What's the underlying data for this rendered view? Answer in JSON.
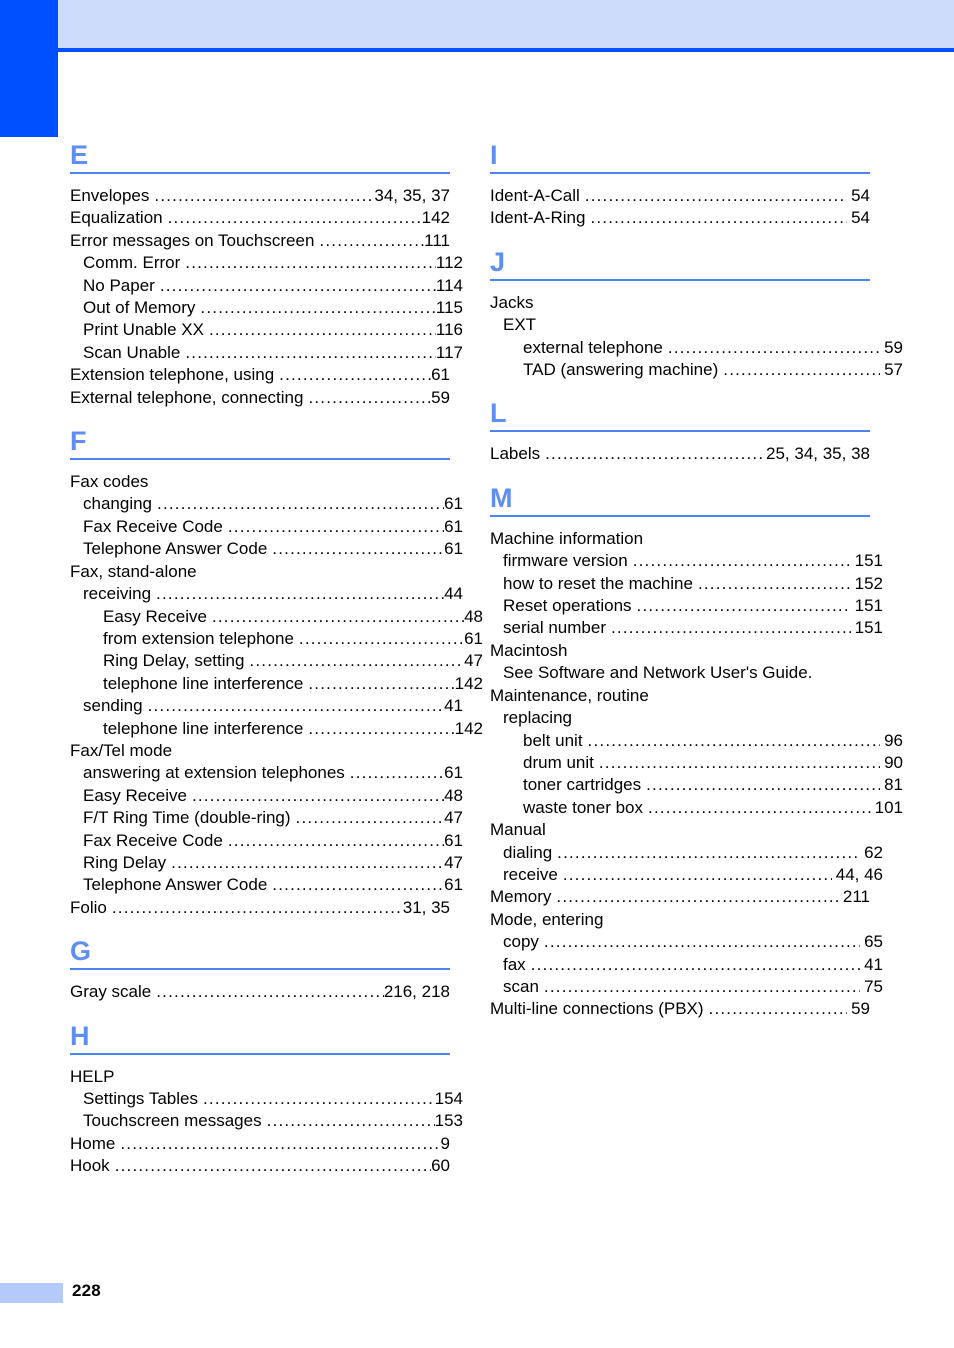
{
  "page": {
    "number": "228",
    "accent_dark_blue": "#0050ff",
    "accent_band_blue": "#ccdcfa",
    "accent_letter_blue": "#5e8ef2",
    "accent_rule_blue": "#4c85f0",
    "footer_block_blue": "#b3cafb"
  },
  "columns": [
    {
      "id": "left",
      "sections": [
        {
          "letter": "E",
          "entries": [
            {
              "label": "Envelopes",
              "pages": "34, 35, 37",
              "level": 0,
              "leader": true
            },
            {
              "label": "Equalization",
              "pages": "142",
              "level": 0,
              "leader": true
            },
            {
              "label": "Error messages on Touchscreen",
              "pages": "111",
              "level": 0,
              "leader": true
            },
            {
              "label": "Comm. Error",
              "pages": "112",
              "level": 1,
              "leader": true
            },
            {
              "label": "No Paper",
              "pages": "114",
              "level": 1,
              "leader": true
            },
            {
              "label": "Out of Memory",
              "pages": "115",
              "level": 1,
              "leader": true
            },
            {
              "label": "Print Unable XX",
              "pages": "116",
              "level": 1,
              "leader": true
            },
            {
              "label": "Scan Unable",
              "pages": "117",
              "level": 1,
              "leader": true
            },
            {
              "label": "Extension telephone, using",
              "pages": "61",
              "level": 0,
              "leader": true
            },
            {
              "label": "External telephone, connecting",
              "pages": "59",
              "level": 0,
              "leader": true
            }
          ]
        },
        {
          "letter": "F",
          "entries": [
            {
              "label": "Fax codes",
              "pages": "",
              "level": 0,
              "leader": false
            },
            {
              "label": "changing",
              "pages": "61",
              "level": 1,
              "leader": true
            },
            {
              "label": "Fax Receive Code",
              "pages": "61",
              "level": 1,
              "leader": true
            },
            {
              "label": "Telephone Answer Code",
              "pages": "61",
              "level": 1,
              "leader": true
            },
            {
              "label": "Fax, stand-alone",
              "pages": "",
              "level": 0,
              "leader": false
            },
            {
              "label": "receiving",
              "pages": "44",
              "level": 1,
              "leader": true
            },
            {
              "label": "Easy Receive",
              "pages": "48",
              "level": 2,
              "leader": true
            },
            {
              "label": "from extension telephone",
              "pages": "61",
              "level": 2,
              "leader": true
            },
            {
              "label": "Ring Delay, setting",
              "pages": "47",
              "level": 2,
              "leader": true
            },
            {
              "label": "telephone line interference",
              "pages": "142",
              "level": 2,
              "leader": true
            },
            {
              "label": "sending",
              "pages": "41",
              "level": 1,
              "leader": true
            },
            {
              "label": "telephone line interference",
              "pages": "142",
              "level": 2,
              "leader": true
            },
            {
              "label": "Fax/Tel mode",
              "pages": "",
              "level": 0,
              "leader": false
            },
            {
              "label": "answering at extension telephones",
              "pages": "61",
              "level": 1,
              "leader": true
            },
            {
              "label": "Easy Receive",
              "pages": "48",
              "level": 1,
              "leader": true
            },
            {
              "label": "F/T Ring Time (double-ring)",
              "pages": "47",
              "level": 1,
              "leader": true
            },
            {
              "label": "Fax Receive Code",
              "pages": "61",
              "level": 1,
              "leader": true
            },
            {
              "label": "Ring Delay",
              "pages": "47",
              "level": 1,
              "leader": true
            },
            {
              "label": "Telephone Answer Code",
              "pages": "61",
              "level": 1,
              "leader": true
            },
            {
              "label": "Folio",
              "pages": "31, 35",
              "level": 0,
              "leader": true
            }
          ]
        },
        {
          "letter": "G",
          "entries": [
            {
              "label": "Gray scale",
              "pages": "216, 218",
              "level": 0,
              "leader": true
            }
          ]
        },
        {
          "letter": "H",
          "entries": [
            {
              "label": "HELP",
              "pages": "",
              "level": 0,
              "leader": false
            },
            {
              "label": "Settings Tables",
              "pages": "154",
              "level": 1,
              "leader": true
            },
            {
              "label": "Touchscreen messages",
              "pages": "153",
              "level": 1,
              "leader": true
            },
            {
              "label": "Home",
              "pages": "9",
              "level": 0,
              "leader": true
            },
            {
              "label": "Hook",
              "pages": "60",
              "level": 0,
              "leader": true
            }
          ]
        }
      ]
    },
    {
      "id": "right",
      "sections": [
        {
          "letter": "I",
          "entries": [
            {
              "label": "Ident-A-Call",
              "pages": "54",
              "level": 0,
              "leader": true
            },
            {
              "label": "Ident-A-Ring",
              "pages": "54",
              "level": 0,
              "leader": true
            }
          ]
        },
        {
          "letter": "J",
          "entries": [
            {
              "label": "Jacks",
              "pages": "",
              "level": 0,
              "leader": false
            },
            {
              "label": "EXT",
              "pages": "",
              "level": 1,
              "leader": false
            },
            {
              "label": "external telephone",
              "pages": "59",
              "level": 2,
              "leader": true
            },
            {
              "label": "TAD (answering machine)",
              "pages": "57",
              "level": 2,
              "leader": true
            }
          ]
        },
        {
          "letter": "L",
          "entries": [
            {
              "label": "Labels",
              "pages": "25, 34, 35, 38",
              "level": 0,
              "leader": true
            }
          ]
        },
        {
          "letter": "M",
          "entries": [
            {
              "label": "Machine information",
              "pages": "",
              "level": 0,
              "leader": false
            },
            {
              "label": "firmware version",
              "pages": "151",
              "level": 1,
              "leader": true
            },
            {
              "label": "how to reset the machine",
              "pages": "152",
              "level": 1,
              "leader": true
            },
            {
              "label": "Reset operations",
              "pages": "151",
              "level": 1,
              "leader": true
            },
            {
              "label": "serial number",
              "pages": "151",
              "level": 1,
              "leader": true
            },
            {
              "label": "Macintosh",
              "pages": "",
              "level": 0,
              "leader": false
            },
            {
              "label": "See Software and Network User's Guide.",
              "pages": "",
              "level": 1,
              "leader": false
            },
            {
              "label": "Maintenance, routine",
              "pages": "",
              "level": 0,
              "leader": false
            },
            {
              "label": "replacing",
              "pages": "",
              "level": 1,
              "leader": false
            },
            {
              "label": "belt unit",
              "pages": "96",
              "level": 2,
              "leader": true
            },
            {
              "label": "drum unit",
              "pages": "90",
              "level": 2,
              "leader": true
            },
            {
              "label": "toner cartridges",
              "pages": "81",
              "level": 2,
              "leader": true
            },
            {
              "label": "waste toner box",
              "pages": "101",
              "level": 2,
              "leader": true
            },
            {
              "label": "Manual",
              "pages": "",
              "level": 0,
              "leader": false
            },
            {
              "label": "dialing",
              "pages": "62",
              "level": 1,
              "leader": true
            },
            {
              "label": "receive",
              "pages": "44, 46",
              "level": 1,
              "leader": true
            },
            {
              "label": "Memory",
              "pages": "211",
              "level": 0,
              "leader": true
            },
            {
              "label": "Mode, entering",
              "pages": "",
              "level": 0,
              "leader": false
            },
            {
              "label": "copy",
              "pages": "65",
              "level": 1,
              "leader": true
            },
            {
              "label": "fax",
              "pages": "41",
              "level": 1,
              "leader": true
            },
            {
              "label": "scan",
              "pages": "75",
              "level": 1,
              "leader": true
            },
            {
              "label": "Multi-line connections (PBX)",
              "pages": "59",
              "level": 0,
              "leader": true
            }
          ]
        }
      ]
    }
  ]
}
